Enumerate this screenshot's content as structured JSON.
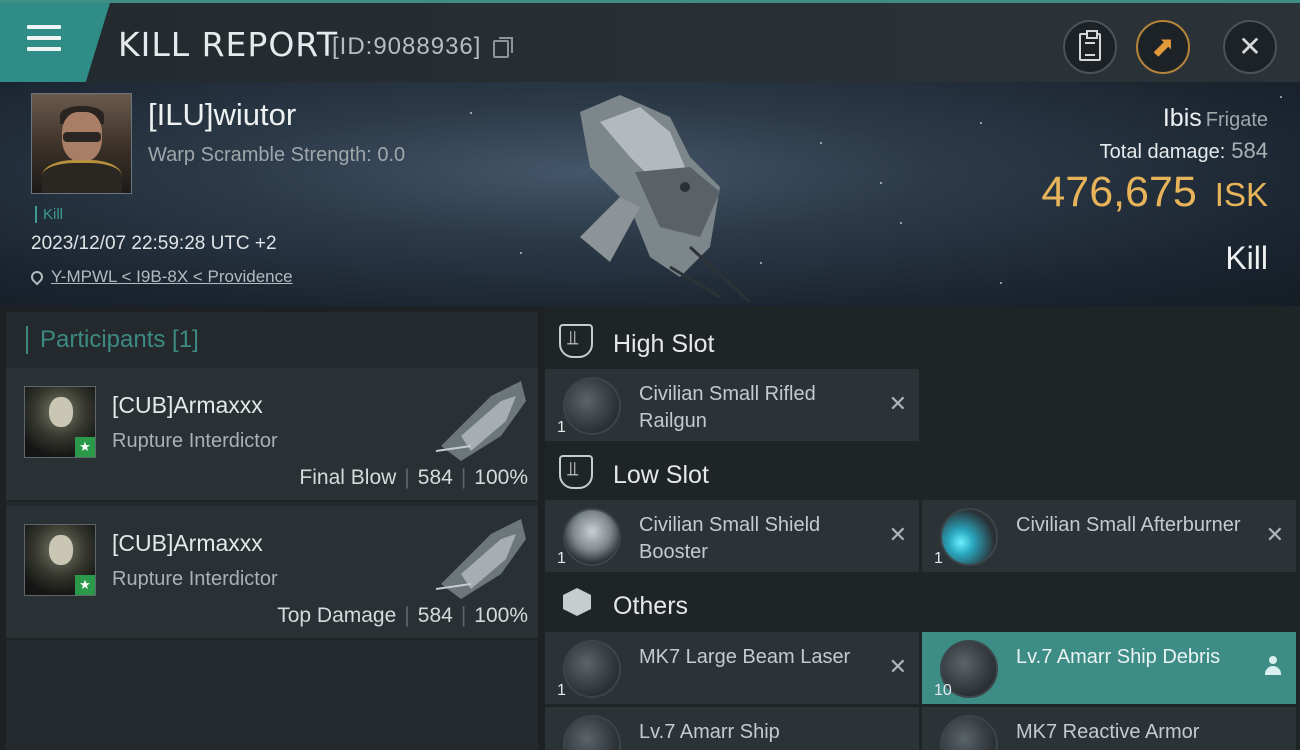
{
  "header": {
    "title": "KILL REPORT",
    "report_id": "[ID:9088936]"
  },
  "victim": {
    "name": "[ILU]wiutor",
    "warp_scramble": "Warp Scramble Strength: 0.0",
    "kill_tag": "Kill",
    "datetime": "2023/12/07 22:59:28 UTC +2",
    "location": "Y-MPWL < I9B-8X < Providence"
  },
  "summary": {
    "ship_name": "Ibis",
    "ship_class": "Frigate",
    "total_damage_label": "Total damage:",
    "total_damage_value": "584",
    "isk_value": "476,675",
    "isk_unit": "ISK",
    "result": "Kill"
  },
  "participants": {
    "title": "Participants [1]",
    "rows": [
      {
        "name": "[CUB]Armaxxx",
        "ship": "Rupture Interdictor",
        "role": "Final Blow",
        "damage": "584",
        "percent": "100%"
      },
      {
        "name": "[CUB]Armaxxx",
        "ship": "Rupture Interdictor",
        "role": "Top Damage",
        "damage": "584",
        "percent": "100%"
      }
    ]
  },
  "slots": {
    "high": {
      "label": "High Slot",
      "items": [
        {
          "name": "Civilian Small Rifled Railgun",
          "qty": "1"
        }
      ]
    },
    "low": {
      "label": "Low Slot",
      "items": [
        {
          "name": "Civilian Small Shield Booster",
          "qty": "1"
        },
        {
          "name": "Civilian Small Afterburner",
          "qty": "1"
        }
      ]
    },
    "others": {
      "label": "Others",
      "items": [
        {
          "name": "MK7 Large Beam Laser",
          "qty": "1"
        },
        {
          "name": "Lv.7 Amarr Ship Debris",
          "qty": "10"
        },
        {
          "name": "Lv.7 Amarr Ship",
          "qty": ""
        },
        {
          "name": "MK7 Reactive Armor",
          "qty": ""
        }
      ]
    }
  },
  "colors": {
    "accent": "#3e8c86",
    "isk": "#e8b45a",
    "export_button": "#e39a3d"
  },
  "icons": [
    "menu-icon",
    "copy-icon",
    "clipboard-icon",
    "export-icon",
    "close-icon",
    "location-pin-icon",
    "high-slot-icon",
    "low-slot-icon",
    "others-cube-icon",
    "remove-icon",
    "person-icon",
    "star-icon"
  ]
}
